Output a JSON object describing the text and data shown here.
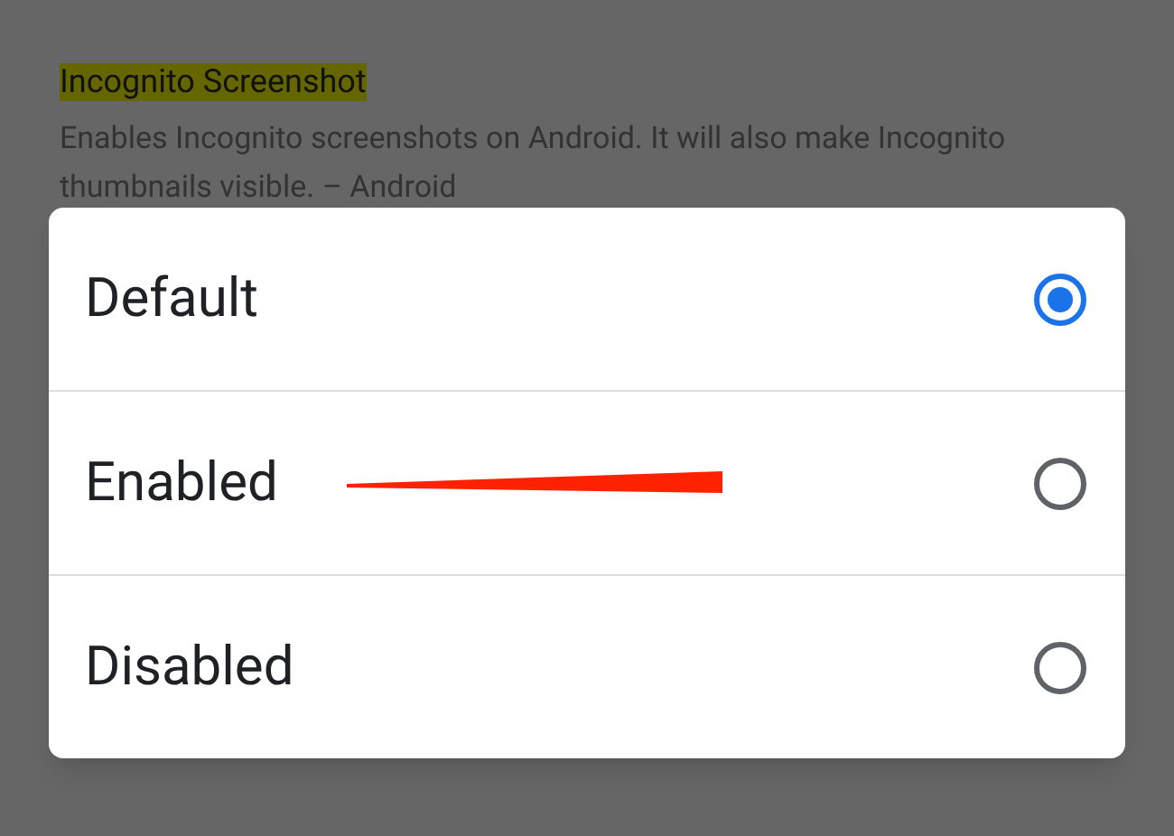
{
  "setting": {
    "title": "Incognito Screenshot",
    "description": "Enables Incognito screenshots on Android. It will also make Incognito thumbnails visible. – Android"
  },
  "dialog": {
    "options": [
      {
        "label": "Default",
        "selected": true
      },
      {
        "label": "Enabled",
        "selected": false
      },
      {
        "label": "Disabled",
        "selected": false
      }
    ]
  }
}
